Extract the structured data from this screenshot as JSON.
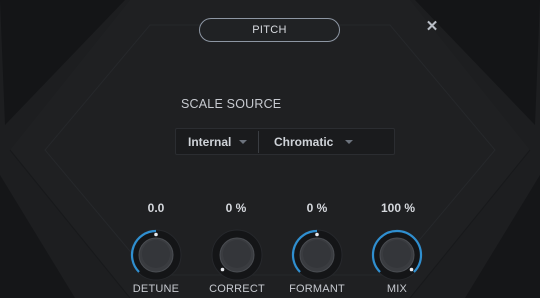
{
  "header": {
    "pitch_label": "PITCH",
    "close_symbol": "✕"
  },
  "scale_source": {
    "title": "SCALE SOURCE",
    "source_value": "Internal",
    "scale_value": "Chromatic"
  },
  "knobs": [
    {
      "label": "DETUNE",
      "value": "0.0",
      "level": 0.5
    },
    {
      "label": "CORRECT",
      "value": "0 %",
      "level": 0.0
    },
    {
      "label": "FORMANT",
      "value": "0 %",
      "level": 0.5
    },
    {
      "label": "MIX",
      "value": "100 %",
      "level": 1.0
    }
  ],
  "colors": {
    "accent": "#2f8fd0",
    "indicator": "#e8eaee",
    "knob_body": "#3a3c40",
    "panel": "#1d1e20"
  }
}
